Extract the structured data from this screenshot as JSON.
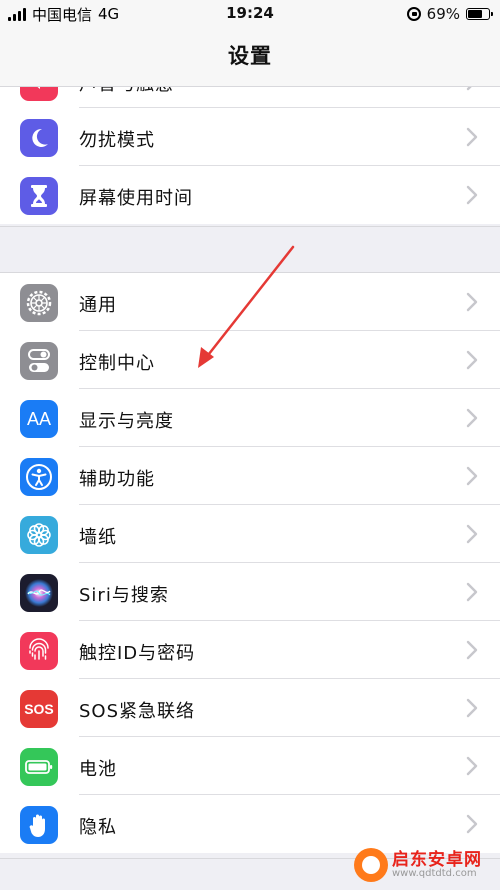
{
  "status_bar": {
    "carrier": "中国电信",
    "network": "4G",
    "time": "19:24",
    "battery_percent": "69%",
    "battery_level": 0.69
  },
  "navbar": {
    "title": "设置"
  },
  "group1": {
    "partial_row_label": "声音与触感",
    "rows": [
      {
        "label": "勿扰模式",
        "icon": "moon-icon",
        "color": "#5e5ce6"
      },
      {
        "label": "屏幕使用时间",
        "icon": "hourglass-icon",
        "color": "#5e5ce6"
      }
    ]
  },
  "group2": {
    "rows": [
      {
        "label": "通用",
        "icon": "gear-icon",
        "color": "#8e8e93"
      },
      {
        "label": "控制中心",
        "icon": "toggles-icon",
        "color": "#8e8e93"
      },
      {
        "label": "显示与亮度",
        "icon": "text-size-icon",
        "color": "#1a7cf5"
      },
      {
        "label": "辅助功能",
        "icon": "accessibility-icon",
        "color": "#1a7cf5"
      },
      {
        "label": "墙纸",
        "icon": "flower-icon",
        "color": "#36aadc"
      },
      {
        "label": "Siri与搜索",
        "icon": "siri-icon",
        "color": "#1c1c2e"
      },
      {
        "label": "触控ID与密码",
        "icon": "fingerprint-icon",
        "color": "#f2385a"
      },
      {
        "label": "SOS紧急联络",
        "icon": "sos-icon",
        "color": "#e53935"
      },
      {
        "label": "电池",
        "icon": "battery-icon",
        "color": "#34c759"
      },
      {
        "label": "隐私",
        "icon": "hand-icon",
        "color": "#1a7cf5"
      }
    ]
  },
  "icon_text": {
    "display": "AA",
    "sos": "SOS"
  },
  "watermark": {
    "name": "启东安卓网",
    "url": "www.qdtdtd.com"
  },
  "colors": {
    "arrow": "#e53935",
    "chevron": "#c7c7cc"
  }
}
